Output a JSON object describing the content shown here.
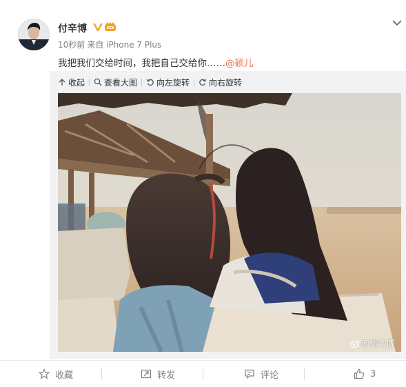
{
  "user": {
    "name": "付辛博"
  },
  "meta": {
    "time": "10秒前",
    "source": "来自 iPhone 7 Plus"
  },
  "post": {
    "text": "我把我们交给时间，我把自己交给你……",
    "mention": "@颖儿"
  },
  "media_tools": {
    "collapse": "收起",
    "view_large": "查看大图",
    "rotate_left": "向左旋转",
    "rotate_right": "向右旋转"
  },
  "photo": {
    "watermark": "@付辛博"
  },
  "actions": {
    "favorite": "收藏",
    "repost": "转发",
    "comment": "评论",
    "like": "3"
  },
  "colors": {
    "mention": "#eb7350",
    "verified": "#f5a623",
    "panel": "#f2f2f5"
  },
  "icons": [
    "chevron-down-icon",
    "verified-icon",
    "vip-crown-icon",
    "collapse-arrow-icon",
    "magnifier-icon",
    "rotate-left-icon",
    "rotate-right-icon",
    "weibo-logo-icon",
    "star-icon",
    "repost-icon",
    "comment-icon",
    "thumbs-up-icon"
  ]
}
